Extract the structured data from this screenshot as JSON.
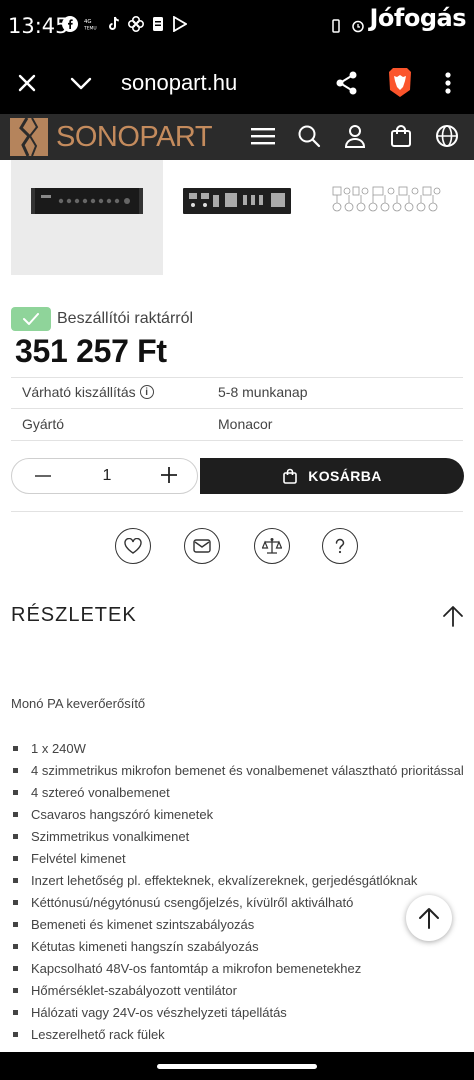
{
  "status_bar": {
    "time": "13:45",
    "watermark": "Jófogás"
  },
  "browser": {
    "url": "sonopart.hu"
  },
  "site": {
    "logo_text": "SONOPART"
  },
  "product": {
    "stock_label": "Beszállítói raktárról",
    "price": "351 257 Ft",
    "specs": [
      {
        "label": "Várható kiszállítás",
        "value": "5-8 munkanap",
        "has_info": true
      },
      {
        "label": "Gyártó",
        "value": "Monacor",
        "has_info": false
      }
    ],
    "quantity": "1",
    "cart_label": "KOSÁRBA"
  },
  "details": {
    "title": "RÉSZLETEK",
    "subtitle": "Monó PA keverőerősítő",
    "features": [
      "1 x 240W",
      "4 szimmetrikus mikrofon bemenet és vonalbemenet választható prioritással",
      "4 sztereó vonalbemenet",
      "Csavaros hangszóró kimenetek",
      "Szimmetrikus vonalkimenet",
      "Felvétel kimenet",
      "Inzert lehetőség pl. effekteknek, ekvalízereknek, gerjedésgátlóknak",
      "Kéttónusú/négytónusú csengőjelzés, kívülről aktiválható",
      "Bemeneti és kimenet szintszabályozás",
      "Kétutas kimeneti hangszín szabályozás",
      "Kapcsolható 48V-os fantomtáp a mikrofon bemenetekhez",
      "Hőmérséklet-szabályozott ventilátor",
      "Hálózati vagy 24V-os vészhelyzeti tápellátás",
      "Leszerelhető rack fülek"
    ]
  }
}
